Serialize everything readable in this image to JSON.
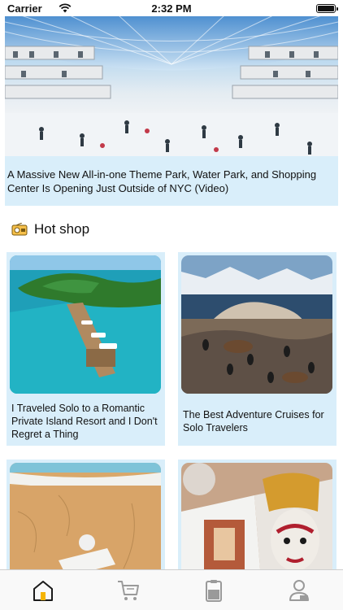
{
  "status": {
    "carrier": "Carrier",
    "time": "2:32 PM"
  },
  "hero": {
    "image": "indoor-water-park-photo",
    "title": "A Massive New All-in-one Theme Park, Water Park, and Shopping Center Is Opening Just Outside of NYC (Video)"
  },
  "section": {
    "icon": "radio-icon",
    "title": "Hot shop"
  },
  "cards": [
    {
      "image": "private-island-resort-photo",
      "title": "I Traveled Solo to a Romantic Private Island Resort and I Don't Regret a Thing"
    },
    {
      "image": "seals-on-rocky-island-photo",
      "title": "The Best Adventure Cruises for Solo Travelers"
    },
    {
      "image": "beach-lounger-photo",
      "title": ""
    },
    {
      "image": "open-magazine-photo",
      "title": ""
    }
  ],
  "tabs": [
    {
      "name": "home",
      "icon": "home-icon",
      "active": true
    },
    {
      "name": "cart",
      "icon": "cart-icon",
      "active": false
    },
    {
      "name": "orders",
      "icon": "clipboard-icon",
      "active": false
    },
    {
      "name": "profile",
      "icon": "user-icon",
      "active": false
    }
  ],
  "colors": {
    "card_background": "#d9eefa",
    "active_tab": "#f5b400",
    "inactive_tab": "#9a9a9a"
  }
}
